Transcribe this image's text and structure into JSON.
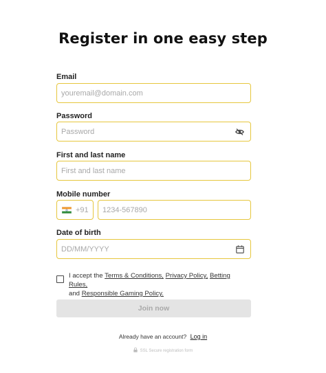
{
  "page": {
    "title": "Register in one easy step"
  },
  "form": {
    "email": {
      "label": "Email",
      "placeholder": "youremail@domain.com",
      "value": ""
    },
    "password": {
      "label": "Password",
      "placeholder": "Password",
      "value": "",
      "toggle_icon": "eye-off-icon"
    },
    "full_name": {
      "label": "First and last name",
      "placeholder": "First and last name",
      "value": ""
    },
    "mobile": {
      "label": "Mobile number",
      "country_flag": "india-flag-icon",
      "country_code": "+91",
      "placeholder": "1234-567890",
      "value": ""
    },
    "dob": {
      "label": "Date of birth",
      "placeholder": "DD/MM/YYYY",
      "value": "",
      "icon": "calendar-icon"
    }
  },
  "consent": {
    "checked": false,
    "prefix": "I accept the",
    "terms": "Terms & Conditions,",
    "privacy": "Privacy Policy,",
    "betting": "Betting Rules,",
    "conjunction": "and",
    "responsible": "Responsible Gaming Policy."
  },
  "submit": {
    "label": "Join now",
    "enabled": false
  },
  "footer": {
    "already_text": "Already have an account?",
    "login_link": "Log in",
    "secure_text": "SSL Secure registration form"
  },
  "colors": {
    "field_border": "#e6c63c",
    "button_disabled_bg": "#e4e4e4",
    "button_disabled_text": "#a9a9a9"
  }
}
